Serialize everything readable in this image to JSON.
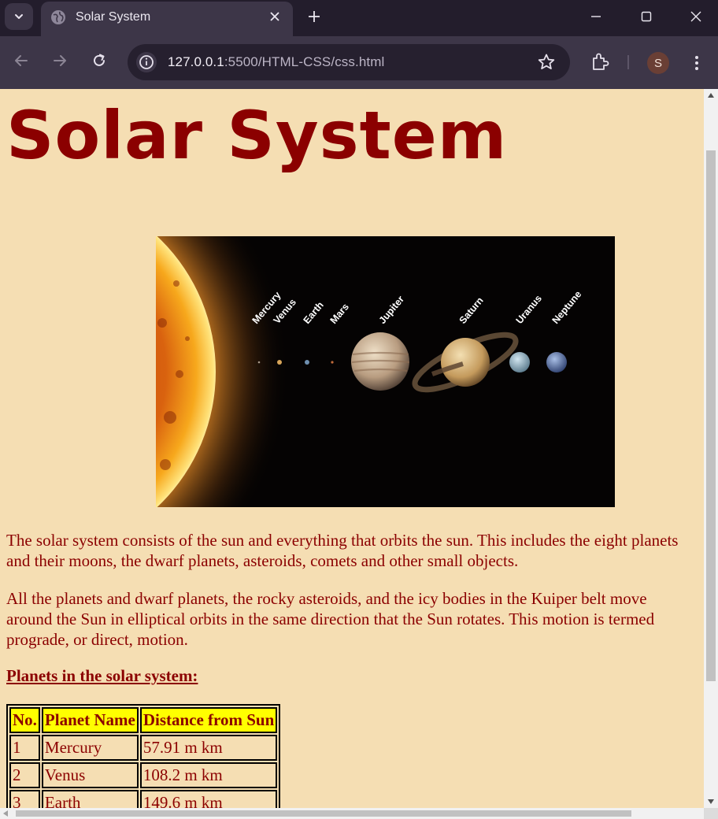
{
  "browser": {
    "tab": {
      "title": "Solar System"
    },
    "omnibox": {
      "url_host": "127.0.0.1",
      "url_rest": ":5500/HTML-CSS/css.html"
    },
    "profile_initial": "S"
  },
  "page": {
    "title": "Solar System",
    "image": {
      "planet_labels": [
        "Mercury",
        "Venus",
        "Earth",
        "Mars",
        "Jupiter",
        "Saturn",
        "Uranus",
        "Neptune"
      ]
    },
    "paragraphs": [
      "The solar system consists of the sun and everything that orbits the sun. This includes the eight planets and their moons, the dwarf planets, asteroids, comets and other small objects.",
      "All the planets and dwarf planets, the rocky asteroids, and the icy bodies in the Kuiper belt move around the Sun in elliptical orbits in the same direction that the Sun rotates. This motion is termed prograde, or direct, motion."
    ],
    "subheading": "Planets in the solar system:",
    "table": {
      "headers": [
        "No.",
        "Planet Name",
        "Distance from Sun"
      ],
      "rows": [
        [
          "1",
          "Mercury",
          "57.91 m km"
        ],
        [
          "2",
          "Venus",
          "108.2 m km"
        ],
        [
          "3",
          "Earth",
          "149.6 m km"
        ]
      ]
    }
  },
  "colors": {
    "page_bg": "#f5deb3",
    "text": "#8b0000",
    "table_header_bg": "#ffff00"
  }
}
